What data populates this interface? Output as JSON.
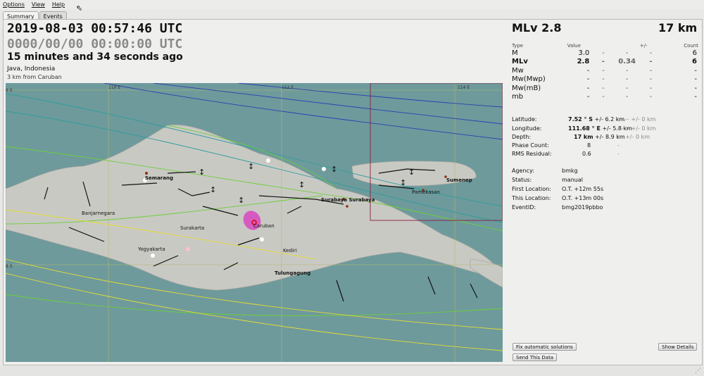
{
  "menu": {
    "options": "Options",
    "view": "View",
    "help": "Help"
  },
  "tabs": {
    "summary": "Summary",
    "events": "Events"
  },
  "origin": {
    "time": "2019-08-03 00:57:46 UTC",
    "time2": "0000/00/00  00:00:00 UTC",
    "elapsed": "15 minutes and 34 seconds ago",
    "region": "Java, Indonesia",
    "nearby": "3 km from Caruban"
  },
  "headline": {
    "magnitude": "MLv 2.8",
    "depth": "17 km"
  },
  "mag_table": {
    "headers": {
      "type": "Type",
      "value": "Value",
      "pm": "+/-",
      "count": "Count"
    },
    "rows": [
      {
        "type": "M",
        "value": "3.0",
        "a": "-",
        "b": "-",
        "c": "-",
        "count": "6"
      },
      {
        "type": "MLv",
        "value": "2.8",
        "a": "-",
        "b": "0.34",
        "c": "-",
        "count": "6"
      },
      {
        "type": "Mw",
        "value": "-",
        "a": "-",
        "b": "-",
        "c": "-",
        "count": "-"
      },
      {
        "type": "Mw(Mwp)",
        "value": "-",
        "a": "-",
        "b": "-",
        "c": "-",
        "count": "-"
      },
      {
        "type": "Mw(mB)",
        "value": "-",
        "a": "-",
        "b": "-",
        "c": "-",
        "count": "-"
      },
      {
        "type": "mb",
        "value": "-",
        "a": "-",
        "b": "-",
        "c": "-",
        "count": "-"
      }
    ]
  },
  "location": {
    "latitude_label": "Latitude:",
    "latitude": "7.52 ° S",
    "latitude_unc": "+/- 6.2 km",
    "latitude_alt": "---.--  +/-  0 km",
    "longitude_label": "Longitude:",
    "longitude": "111.68 ° E",
    "longitude_unc": "+/- 5.8 km",
    "longitude_alt": "---.--  +/-  0 km",
    "depth_label": "Depth:",
    "depth": "17 km",
    "depth_unc": "+/- 8.9 km",
    "depth_alt": "---  +/-  0 km",
    "phase_label": "Phase Count:",
    "phase": "8",
    "phase_alt": "-",
    "rms_label": "RMS Residual:",
    "rms": "0.6",
    "rms_alt": "-"
  },
  "meta": {
    "agency_label": "Agency:",
    "agency": "bmkg",
    "status_label": "Status:",
    "status": "manual",
    "first_label": "First Location:",
    "first": "O.T. +12m 55s",
    "this_label": "This Location:",
    "this": "O.T. +13m 00s",
    "eventid_label": "EventID:",
    "eventid": "bmg2019pbbo"
  },
  "buttons": {
    "fix": "Fix automatic solutions",
    "send": "Send This Data",
    "details": "Show Details"
  },
  "map": {
    "grid_labels": {
      "lon110": "110 E",
      "lon112": "112 E",
      "lon114": "114 E",
      "lat6": "6 S",
      "lat8": "8 S"
    },
    "places": [
      "Semarang",
      "Banjarnegara",
      "Surakarta",
      "Yogyakarta",
      "Caruban",
      "Kediri",
      "Tulungagung",
      "Surabaya Surabaya",
      "Pamekasan",
      "Sumenep"
    ],
    "colors": {
      "sea": "#6e9a9c",
      "land": "#c9c9c4",
      "epicenter": "#e000c0"
    }
  }
}
